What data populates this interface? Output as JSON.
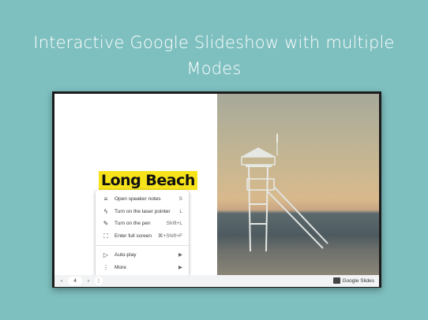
{
  "headline": {
    "line1": "Interactive Google Slideshow with multiple",
    "line2": "Modes"
  },
  "slide": {
    "title": "Long Beach"
  },
  "menu": {
    "items": [
      {
        "label": "Open speaker notes",
        "shortcut": "S",
        "icon": "notes-icon"
      },
      {
        "label": "Turn on the laser pointer",
        "shortcut": "L",
        "icon": "laser-pointer-icon"
      },
      {
        "label": "Turn on the pen",
        "shortcut": "Shift+L",
        "icon": "pen-icon"
      },
      {
        "label": "Enter full screen",
        "shortcut": "⌘+Shift+F",
        "icon": "fullscreen-icon"
      }
    ],
    "submenus": [
      {
        "label": "Auto-play",
        "icon": "play-icon"
      },
      {
        "label": "More",
        "icon": "more-vertical-icon"
      }
    ]
  },
  "toolbar": {
    "page": "4",
    "brand": "Google Slides"
  }
}
